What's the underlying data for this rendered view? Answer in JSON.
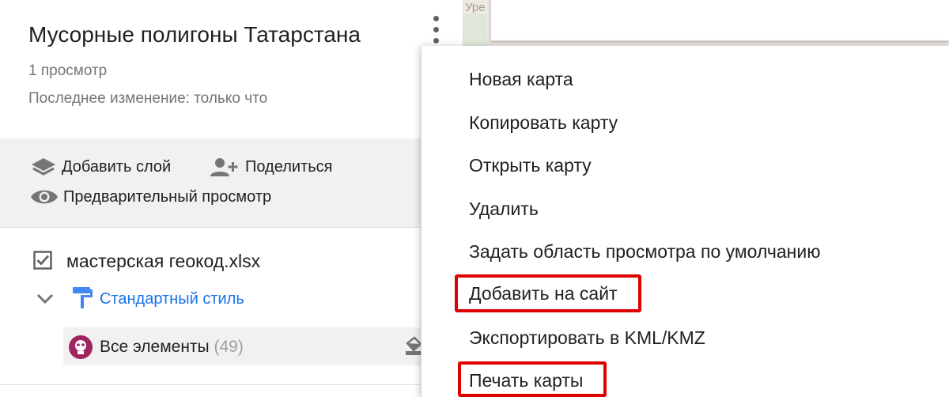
{
  "map": {
    "street_label": "Уре",
    "search_placeholder": ""
  },
  "panel": {
    "title": "Мусорные полигоны Татарстана",
    "views": "1 просмотр",
    "last_edit": "Последнее изменение: только что",
    "actions": {
      "add_layer": "Добавить слой",
      "share": "Поделиться",
      "preview": "Предварительный просмотр"
    },
    "layer": {
      "name": "мастерская геокод.xlsx",
      "checked": true,
      "style_label": "Стандартный стиль",
      "all_items_label": "Все элементы",
      "all_items_count": "(49)",
      "avatar_color": "#a0245e"
    }
  },
  "menu": {
    "items": [
      {
        "label": "Новая карта"
      },
      {
        "label": "Копировать карту"
      },
      {
        "label": "Открыть карту"
      },
      {
        "label": "Удалить"
      },
      {
        "label": "Задать область просмотра по умолчанию"
      },
      {
        "label": "Добавить на сайт",
        "highlighted": true
      },
      {
        "label": "Экспортировать в KML/KMZ"
      },
      {
        "label": "Печать карты",
        "highlighted": true
      }
    ],
    "highlight_color": "#e00000"
  },
  "icons": {
    "more": "more-vert-icon",
    "layers": "layers-icon",
    "share": "person-add-icon",
    "preview": "eye-icon",
    "checkbox": "checkbox-checked-icon",
    "expand": "chevron-down-icon",
    "style": "paint-roller-icon",
    "bucket": "paint-bucket-icon"
  },
  "colors": {
    "link": "#1a73e8",
    "secondary_text": "#757575",
    "toolbar_bg": "#f1f1f1"
  }
}
